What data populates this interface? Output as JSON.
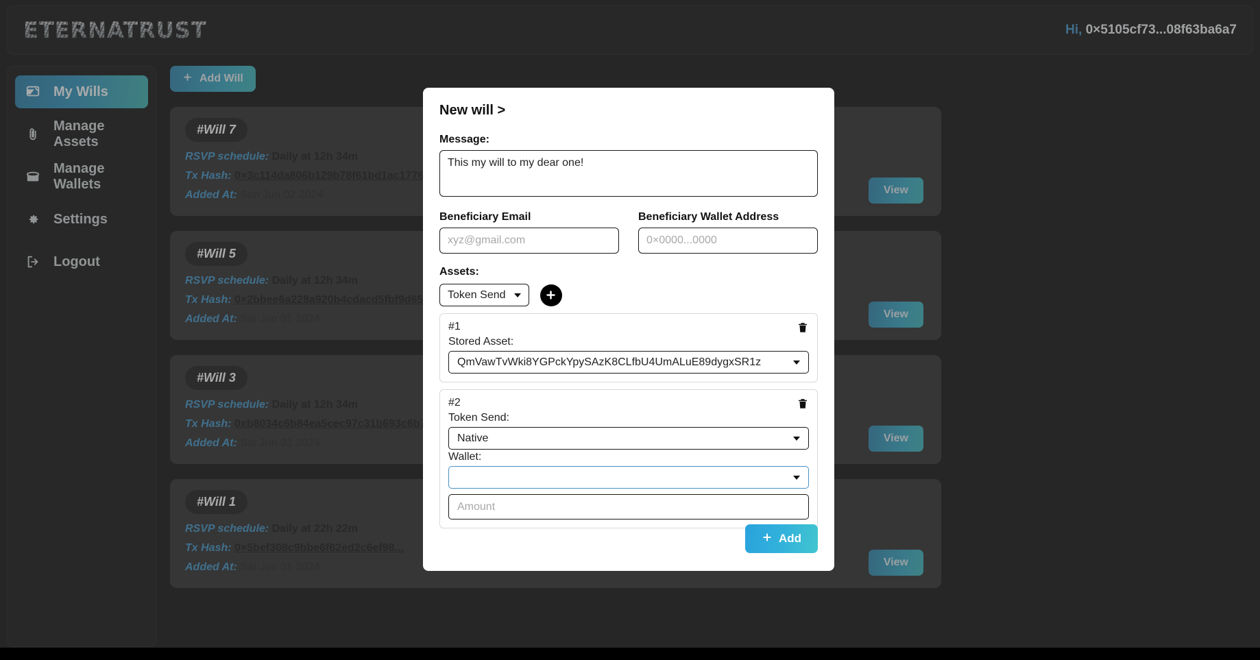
{
  "header": {
    "logo": "ETERNATRUST",
    "greeting_prefix": "Hi,",
    "wallet_address": "0×5105cf73...08f63ba6a7"
  },
  "sidebar": {
    "items": [
      {
        "label": "My Wills",
        "icon": "scroll-icon",
        "active": true
      },
      {
        "label": "Manage Assets",
        "icon": "paperclip-icon",
        "active": false
      },
      {
        "label": "Manage Wallets",
        "icon": "wallet-icon",
        "active": false
      },
      {
        "label": "Settings",
        "icon": "gear-icon",
        "active": false
      },
      {
        "label": "Logout",
        "icon": "logout-icon",
        "active": false
      }
    ]
  },
  "toolbar": {
    "add_will_label": "Add Will",
    "add_will_icon": "plus-icon"
  },
  "wills": {
    "labels": {
      "rsvp": "RSVP schedule:",
      "tx_hash": "Tx Hash:",
      "added_at": "Added At:"
    },
    "view_label": "View",
    "items": [
      {
        "badge": "#Will 7",
        "rsvp": "Daily at 12h 34m",
        "tx_hash": "0×3c114da806b129b78f61bd1ac1776d0ccd3c9ac...",
        "added_at": "Sun Jun 02 2024"
      },
      {
        "badge": "#Will 5",
        "rsvp": "Daily at 12h 34m",
        "tx_hash": "0×2bbee6a228a920b4cdacd5fbf9d6597c02df499...",
        "added_at": "Sat Jun 01 2024"
      },
      {
        "badge": "#Will 3",
        "rsvp": "Daily at 12h 34m",
        "tx_hash": "0xb8034c6b84ea5cec97c31b693c6b7c400fc0a387...",
        "added_at": "Sat Jun 01 2024"
      },
      {
        "badge": "#Will 1",
        "rsvp": "Daily at 22h 22m",
        "tx_hash": "0×5bef308c9bbe6f62ed2c6ef98...",
        "added_at": "Sat Jun 01 2024"
      }
    ]
  },
  "modal": {
    "title": "New will >",
    "message_label": "Message:",
    "message_value": "This my will to my dear one!",
    "beneficiary_email_label": "Beneficiary Email",
    "beneficiary_email_placeholder": "xyz@gmail.com",
    "beneficiary_email_value": "",
    "beneficiary_wallet_label": "Beneficiary Wallet Address",
    "beneficiary_wallet_placeholder": "0×0000...0000",
    "beneficiary_wallet_value": "",
    "assets_label": "Assets:",
    "asset_type_selected": "Token Send",
    "add_asset_icon": "plus-icon",
    "delete_icon": "trash-icon",
    "asset_entries": [
      {
        "index": "#1",
        "field_label": "Stored Asset:",
        "selected": "QmVawTvWki8YGPckYpySAzK8CLfbU4UmALuE89dygxSR1z",
        "focused": false
      },
      {
        "index": "#2",
        "field_label": "Token Send:",
        "selected": "Native",
        "focused": false,
        "wallet_label": "Wallet:",
        "wallet_selected": "",
        "wallet_focused": true,
        "amount_placeholder": "Amount",
        "amount_value": ""
      }
    ],
    "add_button_label": "Add",
    "add_button_icon": "plus-icon"
  },
  "colors": {
    "accent_blue": "#2f7fae",
    "gradient_start": "#1b6f96",
    "gradient_end": "#2aa0a4",
    "add_button_start": "#29a3dd",
    "add_button_end": "#41c6cf",
    "card_bg": "#1d1d1d",
    "focus_border": "#4a90c4"
  }
}
